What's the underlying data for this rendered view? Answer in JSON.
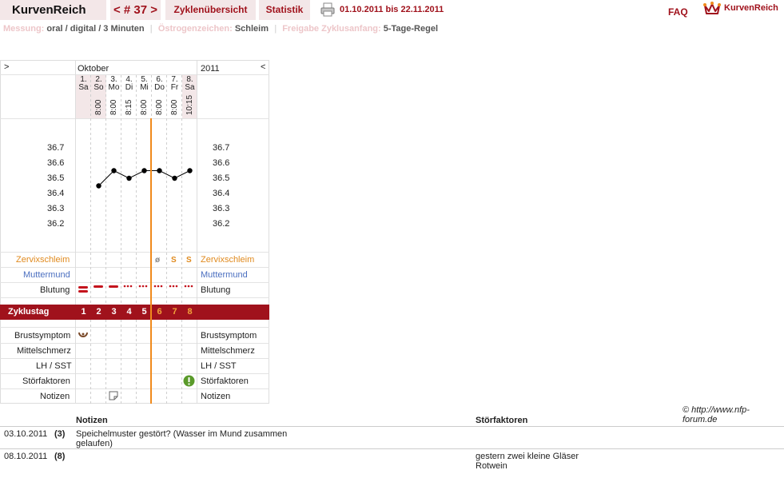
{
  "topbar": {
    "app_title": "KurvenReich",
    "cycle_label": "< # 37 >",
    "overview_label": "Zyklenübersicht",
    "stats_label": "Statistik",
    "date_range": "01.10.2011 bis 22.11.2011",
    "faq_label": "FAQ",
    "brand": "KurvenReich",
    "icons": [
      "printer-icon",
      "crown-icon"
    ]
  },
  "info": {
    "measure_label": "Messung:",
    "measure_value": "oral / digital / 3 Minuten",
    "estrogen_label": "Östrogenzeichen:",
    "estrogen_value": "Schleim",
    "release_label": "Freigabe Zyklusanfang:",
    "release_value": "5-Tage-Regel"
  },
  "chart_nav": {
    "prev": ">",
    "month": "Oktober",
    "year": "2011",
    "next": "<"
  },
  "days": [
    {
      "num": "1.",
      "dow": "Sa",
      "time": ""
    },
    {
      "num": "2.",
      "dow": "So",
      "time": "8:00"
    },
    {
      "num": "3.",
      "dow": "Mo",
      "time": "8:00"
    },
    {
      "num": "4.",
      "dow": "Di",
      "time": "8:15"
    },
    {
      "num": "5.",
      "dow": "Mi",
      "time": "8:00"
    },
    {
      "num": "6.",
      "dow": "Do",
      "time": "8:00"
    },
    {
      "num": "7.",
      "dow": "Fr",
      "time": "8:00"
    },
    {
      "num": "8.",
      "dow": "Sa",
      "time": "10:15"
    }
  ],
  "rows": {
    "cervix": "Zervixschleim",
    "cervix_values": [
      "",
      "",
      "",
      "",
      "",
      "ø",
      "S",
      "S"
    ],
    "muttermund": "Muttermund",
    "bleeding": "Blutung",
    "cycle_day": "Zyklustag",
    "breast": "Brustsymptom",
    "midpain": "Mittelschmerz",
    "lh": "LH / SST",
    "disturb": "Störfaktoren",
    "notes": "Notizen"
  },
  "cycle_days": [
    "1",
    "2",
    "3",
    "4",
    "5",
    "6",
    "7",
    "8"
  ],
  "chart_data": {
    "type": "line",
    "x": [
      "1.",
      "2.",
      "3.",
      "4.",
      "5.",
      "6.",
      "7.",
      "8."
    ],
    "series": [
      {
        "values": [
          null,
          36.45,
          36.55,
          36.5,
          36.55,
          36.55,
          36.5,
          36.55
        ]
      }
    ],
    "yticks": [
      "36.7",
      "36.6",
      "36.5",
      "36.4",
      "36.3",
      "36.2"
    ],
    "ylim": [
      36.2,
      36.7
    ],
    "current_day_marker": "6.",
    "colors": {
      "line": "#000000",
      "today": "#f08a1c",
      "header": "#a0121c"
    }
  },
  "notes_table": {
    "copyright": "© http://www.nfp-forum.de",
    "col_notes": "Notizen",
    "col_disturb": "Störfaktoren",
    "rows": [
      {
        "date": "03.10.2011",
        "day": "(3)",
        "note": "Speichelmuster gestört? (Wasser im Mund zusammen gelaufen)",
        "disturb": ""
      },
      {
        "date": "08.10.2011",
        "day": "(8)",
        "note": "",
        "disturb": "gestern zwei kleine Gläser Rotwein"
      }
    ]
  }
}
